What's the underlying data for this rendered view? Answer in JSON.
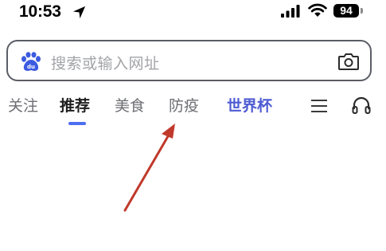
{
  "status_bar": {
    "time": "10:53",
    "battery_level": "94",
    "icons": [
      "location-arrow-icon",
      "cellular-signal-icon",
      "wifi-icon",
      "battery-icon"
    ]
  },
  "search": {
    "placeholder": "搜索或输入网址",
    "icons": [
      "baidu-paw-icon",
      "camera-icon"
    ]
  },
  "tabs": [
    {
      "label": "关注",
      "state": "normal"
    },
    {
      "label": "推荐",
      "state": "active"
    },
    {
      "label": "美食",
      "state": "normal"
    },
    {
      "label": "防疫",
      "state": "normal"
    },
    {
      "label": "世界杯",
      "state": "highlight"
    }
  ],
  "toolbar_icons": [
    "menu-icon",
    "headphone-icon"
  ],
  "colors": {
    "accent": "#4e6ef2",
    "highlight_tab": "#4e5bd2",
    "annotation_arrow": "#c0392b",
    "search_border": "#5b5e66"
  },
  "annotation": {
    "type": "arrow",
    "points_to": "tab 防疫"
  }
}
